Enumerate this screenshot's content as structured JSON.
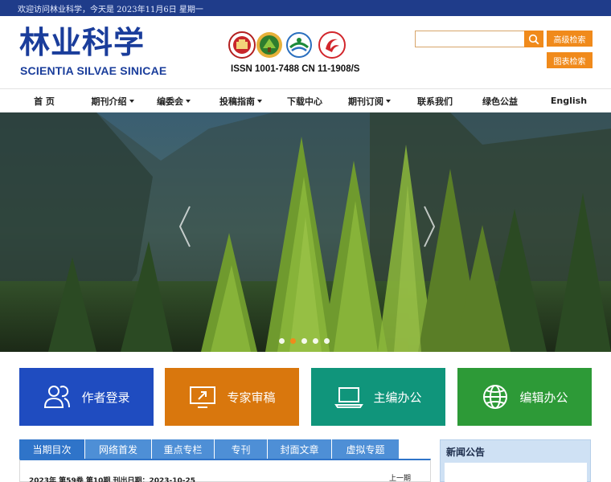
{
  "topbar": {
    "welcome": "欢迎访问林业科学，今天是 2023年11月6日 星期一"
  },
  "header": {
    "title_cn": "林业科学",
    "title_en": "SCIENTIA SILVAE SINICAE",
    "issn": "ISSN 1001-7488 CN 11-1908/S",
    "emblems": [
      "emblem-red-badge-icon",
      "emblem-green-badge-icon",
      "emblem-blue-green-wave-icon",
      "emblem-red-swirl-icon"
    ]
  },
  "search": {
    "value": "",
    "placeholder": "",
    "icon": "search-icon",
    "advanced_label": "高级检索",
    "chart_label": "图表检索"
  },
  "nav": [
    {
      "label": "首 页",
      "dropdown": false
    },
    {
      "label": "期刊介绍",
      "dropdown": true
    },
    {
      "label": "编委会",
      "dropdown": true
    },
    {
      "label": "投稿指南",
      "dropdown": true
    },
    {
      "label": "下载中心",
      "dropdown": false
    },
    {
      "label": "期刊订阅",
      "dropdown": true
    },
    {
      "label": "联系我们",
      "dropdown": false
    },
    {
      "label": "绿色公益",
      "dropdown": false
    },
    {
      "label": "English",
      "dropdown": false
    }
  ],
  "banner": {
    "slide_count": 5,
    "active_slide": 2,
    "prev_icon": "chevron-left-icon",
    "next_icon": "chevron-right-icon"
  },
  "tiles": [
    {
      "label": "作者登录",
      "icon": "users-icon",
      "color": "#1f4cc0"
    },
    {
      "label": "专家审稿",
      "icon": "screen-share-icon",
      "color": "#d9770d"
    },
    {
      "label": "主编办公",
      "icon": "laptop-icon",
      "color": "#10957b"
    },
    {
      "label": "编辑办公",
      "icon": "globe-icon",
      "color": "#2d9a37"
    }
  ],
  "tabs": [
    {
      "label": "当期目次",
      "active": true
    },
    {
      "label": "网络首发",
      "active": false
    },
    {
      "label": "重点专栏",
      "active": false
    },
    {
      "label": "专刊",
      "active": false
    },
    {
      "label": "封面文章",
      "active": false
    },
    {
      "label": "虚拟专题",
      "active": false
    }
  ],
  "issue": {
    "line": "2023年 第59卷 第10期 刊出日期：2023-10-25",
    "prev": "上一期"
  },
  "news": {
    "title": "新闻公告"
  }
}
